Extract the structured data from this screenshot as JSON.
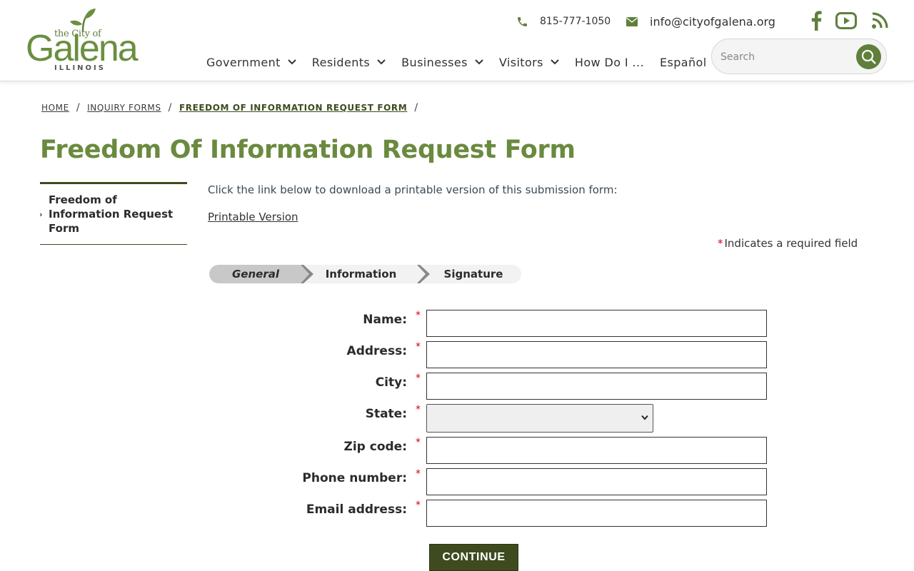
{
  "logo": {
    "line1": "the City of",
    "main": "Galena",
    "state": "ILLINOIS"
  },
  "contact": {
    "phone": "815-777-1050",
    "email": "info@cityofgalena.org"
  },
  "social": [
    "facebook-icon",
    "youtube-icon",
    "rss-icon"
  ],
  "nav": {
    "items": [
      {
        "label": "Government",
        "has_dropdown": true
      },
      {
        "label": "Residents",
        "has_dropdown": true
      },
      {
        "label": "Businesses",
        "has_dropdown": true
      },
      {
        "label": "Visitors",
        "has_dropdown": true
      },
      {
        "label": "How Do I ...",
        "has_dropdown": false
      },
      {
        "label": "Español",
        "has_dropdown": false
      }
    ]
  },
  "search": {
    "placeholder": "Search"
  },
  "breadcrumb": {
    "items": [
      "HOME",
      "INQUIRY FORMS",
      "FREEDOM OF INFORMATION REQUEST FORM"
    ]
  },
  "page": {
    "title": "Freedom Of Information Request Form",
    "intro": "Click the link below to download a printable version of this submission form:",
    "printable_link": "Printable Version",
    "required_star": "*",
    "required_note": "Indicates a required field"
  },
  "sidebar": {
    "items": [
      "Freedom of Information Request Form"
    ]
  },
  "steps": {
    "items": [
      "General",
      "Information",
      "Signature"
    ],
    "active": "General"
  },
  "form": {
    "fields": [
      {
        "label": "Name:",
        "type": "text",
        "value": ""
      },
      {
        "label": "Address:",
        "type": "text",
        "value": ""
      },
      {
        "label": "City:",
        "type": "text",
        "value": ""
      },
      {
        "label": "State:",
        "type": "select",
        "value": ""
      },
      {
        "label": "Zip code:",
        "type": "text",
        "value": ""
      },
      {
        "label": "Phone number:",
        "type": "text",
        "value": ""
      },
      {
        "label": "Email address:",
        "type": "text",
        "value": ""
      }
    ],
    "required_mark": "*",
    "submit_label": "CONTINUE"
  },
  "colors": {
    "brand_green": "#6a8a3e",
    "dark_green": "#3d4b1e",
    "required_red": "#d0021b"
  }
}
